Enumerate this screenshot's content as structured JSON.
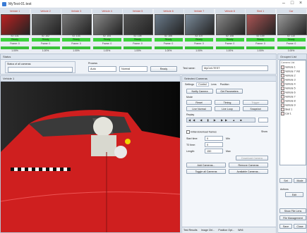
{
  "window": {
    "title": "MyTest-01.test"
  },
  "cameras": [
    {
      "name": "Vehicle 1",
      "id": "ID: 101",
      "status": "Ready",
      "frame": "Frame: 0",
      "pct": "1.00%"
    },
    {
      "name": "Vehicle 2",
      "id": "ID: 102",
      "status": "Ready",
      "frame": "Frame: 0",
      "pct": "1.00%"
    },
    {
      "name": "Vehicle 3",
      "id": "ID: 103",
      "status": "Ready",
      "frame": "Frame: 0",
      "pct": "1.00%"
    },
    {
      "name": "Vehicle 4",
      "id": "ID: 104",
      "status": "Ready",
      "frame": "Frame: 0",
      "pct": "1.00%"
    },
    {
      "name": "Vehicle 5",
      "id": "ID: 105",
      "status": "Ready",
      "frame": "Frame: 0",
      "pct": "1.00%"
    },
    {
      "name": "Vehicle 6",
      "id": "ID: 106",
      "status": "Ready",
      "frame": "Frame: 0",
      "pct": "1.00%"
    },
    {
      "name": "Vehicle 7",
      "id": "ID: 107",
      "status": "Ready",
      "frame": "Frame: 0",
      "pct": "1.00%"
    },
    {
      "name": "Vehicle 8",
      "id": "ID: 108",
      "status": "Ready",
      "frame": "Frame: 0",
      "pct": "1.00%"
    },
    {
      "name": "Sled 1",
      "id": "ID: 109",
      "status": "Ready",
      "frame": "Frame: 0",
      "pct": "1.00%"
    },
    {
      "name": "Car",
      "id": "ID: 110",
      "status": "Ready",
      "frame": "Frame: 0",
      "pct": "1.00%"
    }
  ],
  "status_panel": {
    "title": "Status",
    "status_label": "Status of all cameras",
    "process_label": "Process",
    "process_value": "Auto",
    "mode_value": "Normal",
    "ready_button": "Ready",
    "test_name_label": "Test name:",
    "test_name_value": "MyCell-TEST"
  },
  "video_panel": {
    "title": "Vehicle 1"
  },
  "camera_panel": {
    "title": "Selected Cameras",
    "tabs": [
      "Settings",
      "Control",
      "Lens",
      "Position"
    ],
    "notify_button": "Notify Camera",
    "get_params_button": "Get Parameters",
    "mode_label": "Mode",
    "reset_button": "Reset",
    "trigger_button": "Trigger",
    "live_normal_button": "Live Normal",
    "live_loop_button": "Live Loop",
    "snapshot_button": "Snapshot",
    "replay_label": "Replay",
    "initial_download_label": "Initial download frames",
    "show_label": "Show",
    "start_label": "Start time:",
    "start_value": "0",
    "start_unit": "Min",
    "end_label": "T0 time:",
    "end_value": "0",
    "length_label": "Length:",
    "length_value": "150",
    "length_unit": "Max",
    "download_button": "Download Camera",
    "add_button": "Add Cameras...",
    "remove_button": "Remove Cameras",
    "toggle_button": "Toggle all Cameras",
    "available_button": "Available Cameras...",
    "bottom_tabs": [
      "Test Results",
      "Image Ctrl...",
      "Position Opt...",
      "Wh5"
    ]
  },
  "list_panel": {
    "title": "Grouped List",
    "header": "Camera List",
    "items": [
      "Vehicle 1",
      "Vehicle 7 Vid",
      "Vehicle 2",
      "Vehicle 3",
      "Vehicle 4",
      "Vehicle 5",
      "Vehicle 6",
      "Vehicle 7",
      "Vehicle 8",
      "Vehicle 9",
      "Sled 1",
      "Car 1"
    ],
    "set_button": "Set",
    "mode_button": "Mode",
    "actions_label": "Actions",
    "edit_button": "Edit",
    "show_file_button": "Show File Lens",
    "file_mgmt_button": "File Management",
    "save_button": "Save",
    "close_button": "Close"
  },
  "colors": {
    "ready": "#3bd13b",
    "accent": "#c0392b",
    "header": "#dde5ef"
  }
}
